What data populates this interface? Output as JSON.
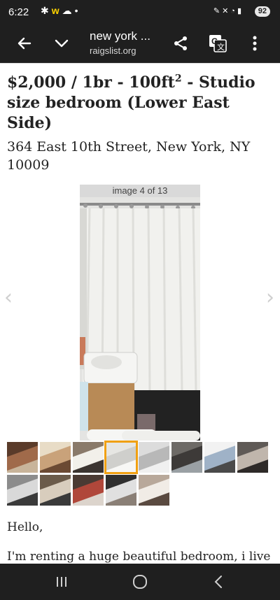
{
  "status_bar": {
    "time": "6:22",
    "left_icons": [
      "asterisk-icon",
      "w-badge-icon",
      "weather-icon",
      "dot-icon"
    ],
    "right_icons": [
      "pen-icon",
      "mute-icon",
      "wifi-icon",
      "signal-icon"
    ],
    "battery": "92"
  },
  "toolbar": {
    "title": "new york ...",
    "url": "raigslist.org"
  },
  "listing": {
    "title_main": "$2,000 / 1br - 100ft",
    "title_sup": "2",
    "title_rest": " - Studio size bedroom (Lower East Side)",
    "address": "364 East 10th Street, New York, NY 10009"
  },
  "gallery": {
    "counter": "image 4 of 13",
    "current_index": 4,
    "total": 13,
    "prev_arrow": "‹",
    "next_arrow": "›"
  },
  "thumbnails": [
    {
      "label": "thumb-1",
      "colors": [
        "#5a3b2a",
        "#a06a4a",
        "#c8b49a"
      ]
    },
    {
      "label": "thumb-2",
      "colors": [
        "#e8dcc6",
        "#c9a27a",
        "#6b4a33"
      ]
    },
    {
      "label": "thumb-3",
      "colors": [
        "#8a7a6a",
        "#f2f0ea",
        "#3b3430"
      ]
    },
    {
      "label": "thumb-4",
      "colors": [
        "#e6e6e3",
        "#cfcfcc",
        "#f7f7f5"
      ]
    },
    {
      "label": "thumb-5",
      "colors": [
        "#dcdcdc",
        "#b8b8b8",
        "#f0f0f0"
      ]
    },
    {
      "label": "thumb-6",
      "colors": [
        "#6d6a66",
        "#3d3a38",
        "#9aa0a4"
      ]
    },
    {
      "label": "thumb-7",
      "colors": [
        "#f2f2f2",
        "#9fb2c7",
        "#4a4a4a"
      ]
    },
    {
      "label": "thumb-8",
      "colors": [
        "#5f5a56",
        "#c0b6ac",
        "#2e2a28"
      ]
    },
    {
      "label": "thumb-9",
      "colors": [
        "#8c8c8c",
        "#d9d9d9",
        "#3a3a3a"
      ]
    },
    {
      "label": "thumb-10",
      "colors": [
        "#6b5b4a",
        "#d8cdbd",
        "#3a3a3a"
      ]
    },
    {
      "label": "thumb-11",
      "colors": [
        "#4a3a33",
        "#b0473a",
        "#dcd4cc"
      ]
    },
    {
      "label": "thumb-12",
      "colors": [
        "#2f2f2f",
        "#e0e0e0",
        "#8a7f76"
      ]
    },
    {
      "label": "thumb-13",
      "colors": [
        "#b8a89a",
        "#f1ece6",
        "#5a4a40"
      ]
    }
  ],
  "body": {
    "greeting": "Hello,",
    "text_line1": "I'm renting a huge beautiful bedroom, i live"
  },
  "colors": {
    "bar_background": "#1f1f1f",
    "selected_thumb_outline": "#f0a012"
  }
}
